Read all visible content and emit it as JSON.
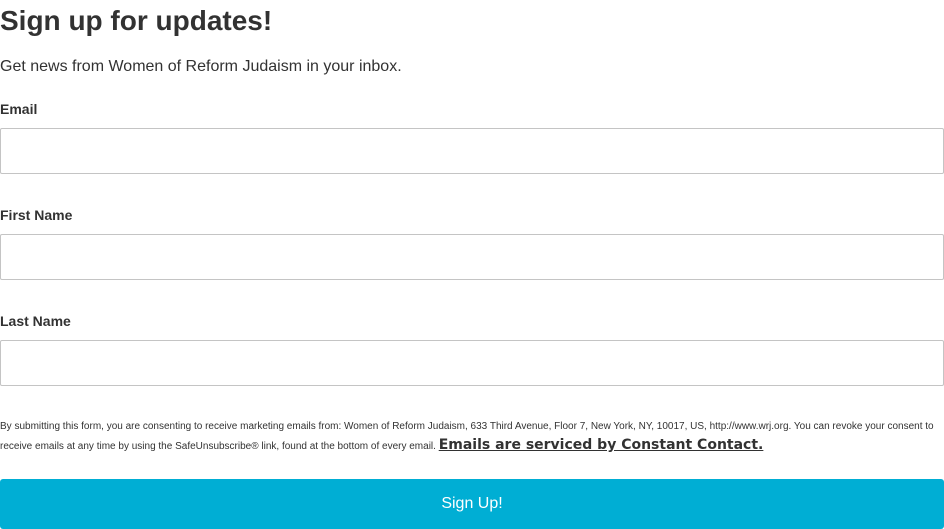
{
  "header": {
    "title": "Sign up for updates!",
    "subtitle": "Get news from Women of Reform Judaism in your inbox."
  },
  "fields": {
    "email": {
      "label": "Email",
      "value": ""
    },
    "first_name": {
      "label": "First Name",
      "value": ""
    },
    "last_name": {
      "label": "Last Name",
      "value": ""
    }
  },
  "consent": {
    "text": "By submitting this form, you are consenting to receive marketing emails from: Women of Reform Judaism, 633 Third Avenue, Floor 7, New York, NY, 10017, US, http://www.wrj.org. You can revoke your consent to receive emails at any time by using the SafeUnsubscribe® link, found at the bottom of every email. ",
    "link_text": "Emails are serviced by Constant Contact."
  },
  "submit": {
    "label": "Sign Up!"
  },
  "colors": {
    "button_bg": "#00aed4",
    "button_text": "#ffffff",
    "text": "#323232",
    "field_border": "#c4c4c4"
  }
}
